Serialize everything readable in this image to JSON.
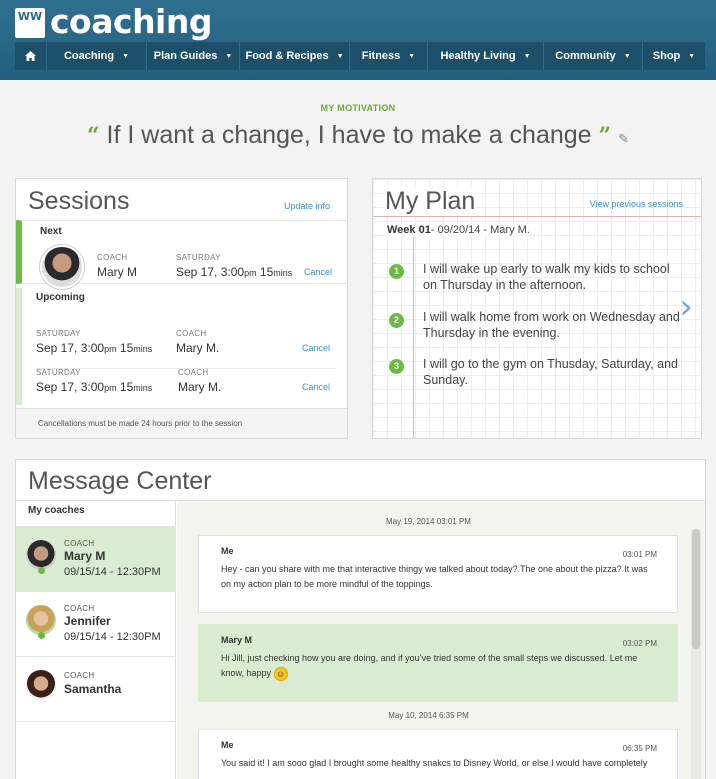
{
  "brand": {
    "logo_mark": "WW",
    "title": "coaching"
  },
  "nav": {
    "home_icon": "home-icon",
    "items": [
      {
        "label": "Coaching"
      },
      {
        "label": "Plan Guides"
      },
      {
        "label": "Food & Recipes"
      },
      {
        "label": "Fitness"
      },
      {
        "label": "Healthy Living"
      },
      {
        "label": "Community"
      },
      {
        "label": "Shop"
      }
    ]
  },
  "motivation": {
    "label": "MY MOTIVATION",
    "quote": "If I want a change, I have to make a change",
    "open_quote": "“",
    "close_quote": "”"
  },
  "sessions": {
    "title": "Sessions",
    "update_link": "Update info",
    "next": {
      "heading": "Next",
      "coach_label": "COACH",
      "coach": "Mary M",
      "day_label": "SATURDAY",
      "date": "Sep 17, 3:00",
      "ampm": "pm",
      "duration": "15",
      "duration_unit": "mins",
      "cancel": "Cancel"
    },
    "upcoming": {
      "heading": "Upcoming",
      "rows": [
        {
          "day_label": "SATURDAY",
          "date": "Sep 17, 3:00",
          "ampm": "pm",
          "duration": "15",
          "duration_unit": "mins",
          "coach_label": "COACH",
          "coach": "Mary M.",
          "cancel": "Cancel"
        },
        {
          "day_label": "SATURDAY",
          "date": "Sep 17, 3:00",
          "ampm": "pm",
          "duration": "15",
          "duration_unit": "mins",
          "coach_label": "COACH",
          "coach": "Mary M.",
          "cancel": "Cancel"
        }
      ]
    },
    "note": "Cancellations must be made 24 hours prior to the session"
  },
  "plan": {
    "title": "My Plan",
    "prev_link": "View previous sessions",
    "week_label": "Week 01",
    "week_rest": "- 09/20/14 - Mary M.",
    "goals": [
      {
        "num": "1",
        "text": "I will wake up early to walk my kids to school on Thursday in the afternoon."
      },
      {
        "num": "2",
        "text": "I will walk home from work on Wednesday and Thursday in the evening."
      },
      {
        "num": "3",
        "text": "I will go to the gym on Thusday, Saturday, and Sunday."
      }
    ]
  },
  "messages": {
    "title": "Message Center",
    "coaches_heading": "My coaches",
    "coaches": [
      {
        "label": "COACH",
        "name": "Mary M",
        "date": "09/15/14 - 12:30PM",
        "active": true
      },
      {
        "label": "COACH",
        "name": "Jennifer",
        "date": "09/15/14 - 12:30PM",
        "active": false
      },
      {
        "label": "COACH",
        "name": "Samantha",
        "date": "",
        "active": false
      }
    ],
    "thread": {
      "stamp1": "May 19, 2014  03:01 PM",
      "msg1": {
        "from": "Me",
        "time": "03:01 PM",
        "text": "Hey - can you share with me that interactive thingy we talked about today? The one about the pizza? It was on my action plan to be more mindful of the toppings."
      },
      "msg2": {
        "from": "Mary M",
        "time": "03:02 PM",
        "text": "Hi Jill, just checking how you are doing, and if you’ve tried some of the small steps we discussed. Let me know, happy"
      },
      "stamp2": "May 10, 2014  6:35 PM",
      "msg3": {
        "from": "Me",
        "time": "06:35 PM",
        "text": "You said it! I am sooo glad I brought some healthy snakcs to Disney World, or else I would have completely"
      }
    }
  },
  "colors": {
    "header": "#2b6889",
    "nav": "#1c4f69",
    "accent_green": "#6aba45",
    "link": "#3a8ed0"
  }
}
